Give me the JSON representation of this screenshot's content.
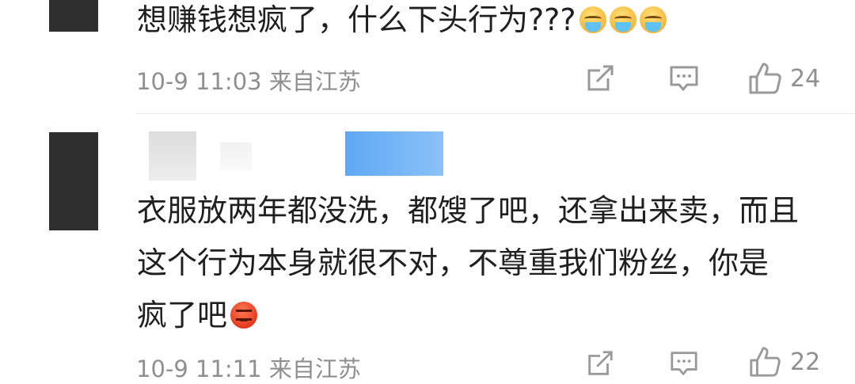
{
  "comments": [
    {
      "text": "想赚钱想疯了，什么下头行为???",
      "emoji": "tears-emoji",
      "meta": "10-9 11:03 来自江苏",
      "likes": "24"
    },
    {
      "lines": [
        "衣服放两年都没洗，都馊了吧，还拿出来卖，而且",
        "这个行为本身就很不对，不尊重我们粉丝，你是",
        "疯了吧"
      ],
      "emoji": "angry-emoji",
      "meta": "10-9 11:11 来自江苏",
      "likes": "22"
    }
  ],
  "icons": {
    "share": "share-icon",
    "reply": "comment-icon",
    "like": "thumbs-up-icon"
  },
  "colors": {
    "text": "#1f1f1f",
    "meta": "#8f8f8f",
    "divider": "#e8e8e8",
    "avatar_placeholder": "#2f2f2f",
    "username_blur": "#74b3f5"
  }
}
